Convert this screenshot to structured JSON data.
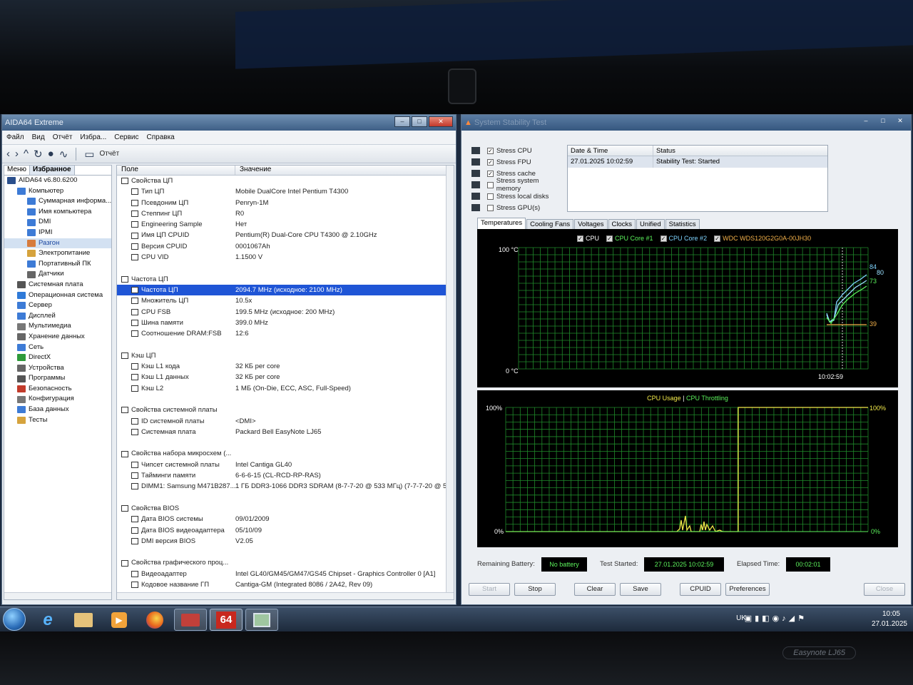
{
  "aida": {
    "title": "AIDA64 Extreme",
    "menu": [
      "Файл",
      "Вид",
      "Отчёт",
      "Избра...",
      "Сервис",
      "Справка"
    ],
    "toolbar_report": "Отчёт",
    "left_tabs": [
      "Меню",
      "Избранное"
    ],
    "tree": [
      {
        "label": "AIDA64 v6.80.6200",
        "color": "#2a4f8c",
        "indent": 0
      },
      {
        "label": "Компьютер",
        "color": "#3d7bd6",
        "indent": 1
      },
      {
        "label": "Суммарная информа...",
        "color": "#3d7bd6",
        "indent": 2
      },
      {
        "label": "Имя компьютера",
        "color": "#3d7bd6",
        "indent": 2
      },
      {
        "label": "DMI",
        "color": "#3d7bd6",
        "indent": 2
      },
      {
        "label": "IPMI",
        "color": "#3d7bd6",
        "indent": 2
      },
      {
        "label": "Разгон",
        "color": "#d67b3d",
        "indent": 2,
        "selected": true
      },
      {
        "label": "Электропитание",
        "color": "#d6a33d",
        "indent": 2
      },
      {
        "label": "Портативный ПК",
        "color": "#3d7bd6",
        "indent": 2
      },
      {
        "label": "Датчики",
        "color": "#666666",
        "indent": 2
      },
      {
        "label": "Системная плата",
        "color": "#555555",
        "indent": 1
      },
      {
        "label": "Операционная система",
        "color": "#2f7ad8",
        "indent": 1
      },
      {
        "label": "Сервер",
        "color": "#3d7bd6",
        "indent": 1
      },
      {
        "label": "Дисплей",
        "color": "#3d7bd6",
        "indent": 1
      },
      {
        "label": "Мультимедиа",
        "color": "#777777",
        "indent": 1
      },
      {
        "label": "Хранение данных",
        "color": "#666666",
        "indent": 1
      },
      {
        "label": "Сеть",
        "color": "#3d7bd6",
        "indent": 1
      },
      {
        "label": "DirectX",
        "color": "#2e9a3a",
        "indent": 1
      },
      {
        "label": "Устройства",
        "color": "#666666",
        "indent": 1
      },
      {
        "label": "Программы",
        "color": "#555555",
        "indent": 1
      },
      {
        "label": "Безопасность",
        "color": "#c23b2b",
        "indent": 1
      },
      {
        "label": "Конфигурация",
        "color": "#777777",
        "indent": 1
      },
      {
        "label": "База данных",
        "color": "#3d7bd6",
        "indent": 1
      },
      {
        "label": "Тесты",
        "color": "#d6a33d",
        "indent": 1
      }
    ],
    "columns": [
      "Поле",
      "Значение"
    ],
    "rows": [
      {
        "type": "sec",
        "field": "Свойства ЦП",
        "value": ""
      },
      {
        "type": "item",
        "field": "Тип ЦП",
        "value": "Mobile DualCore Intel Pentium T4300"
      },
      {
        "type": "item",
        "field": "Псевдоним ЦП",
        "value": "Penryn-1M"
      },
      {
        "type": "item",
        "field": "Степпинг ЦП",
        "value": "R0"
      },
      {
        "type": "item",
        "field": "Engineering Sample",
        "value": "Нет"
      },
      {
        "type": "item",
        "field": "Имя ЦП CPUID",
        "value": "Pentium(R) Dual-Core CPU T4300 @ 2.10GHz"
      },
      {
        "type": "item",
        "field": "Версия CPUID",
        "value": "0001067Ah"
      },
      {
        "type": "item",
        "field": "CPU VID",
        "value": "1.1500 V"
      },
      {
        "type": "gap",
        "field": "",
        "value": ""
      },
      {
        "type": "sec",
        "field": "Частота ЦП",
        "value": ""
      },
      {
        "type": "item",
        "field": "Частота ЦП",
        "value": "2094.7 MHz  (исходное: 2100 MHz)",
        "hl": true
      },
      {
        "type": "item",
        "field": "Множитель ЦП",
        "value": "10.5x"
      },
      {
        "type": "item",
        "field": "CPU FSB",
        "value": "199.5 MHz  (исходное: 200 MHz)"
      },
      {
        "type": "item",
        "field": "Шина памяти",
        "value": "399.0 MHz"
      },
      {
        "type": "item",
        "field": "Соотношение DRAM:FSB",
        "value": "12:6"
      },
      {
        "type": "gap",
        "field": "",
        "value": ""
      },
      {
        "type": "sec",
        "field": "Кэш ЦП",
        "value": ""
      },
      {
        "type": "item",
        "field": "Кэш L1 кода",
        "value": "32 КБ per core"
      },
      {
        "type": "item",
        "field": "Кэш L1 данных",
        "value": "32 КБ per core"
      },
      {
        "type": "item",
        "field": "Кэш L2",
        "value": "1 МБ  (On-Die, ECC, ASC, Full-Speed)"
      },
      {
        "type": "gap",
        "field": "",
        "value": ""
      },
      {
        "type": "sec",
        "field": "Свойства системной платы",
        "value": ""
      },
      {
        "type": "item",
        "field": "ID системной платы",
        "value": "<DMI>"
      },
      {
        "type": "item",
        "field": "Системная плата",
        "value": "Packard Bell EasyNote LJ65"
      },
      {
        "type": "gap",
        "field": "",
        "value": ""
      },
      {
        "type": "sec",
        "field": "Свойства набора микросхем (...",
        "value": ""
      },
      {
        "type": "item",
        "field": "Чипсет системной платы",
        "value": "Intel Cantiga GL40"
      },
      {
        "type": "item",
        "field": "Тайминги памяти",
        "value": "6-6-6-15  (CL-RCD-RP-RAS)"
      },
      {
        "type": "item",
        "field": "DIMM1: Samsung M471B287...",
        "value": "1 ГБ DDR3-1066 DDR3 SDRAM  (8-7-7-20 @ 533 МГц)  (7-7-7-20 @ 53"
      },
      {
        "type": "gap",
        "field": "",
        "value": ""
      },
      {
        "type": "sec",
        "field": "Свойства BIOS",
        "value": ""
      },
      {
        "type": "item",
        "field": "Дата BIOS системы",
        "value": "09/01/2009"
      },
      {
        "type": "item",
        "field": "Дата BIOS видеоадаптера",
        "value": "05/10/09"
      },
      {
        "type": "item",
        "field": "DMI версия BIOS",
        "value": "V2.05"
      },
      {
        "type": "gap",
        "field": "",
        "value": ""
      },
      {
        "type": "sec",
        "field": "Свойства графического проц...",
        "value": ""
      },
      {
        "type": "item",
        "field": "Видеоадаптер",
        "value": "Intel GL40/GM45/GM47/GS45 Chipset - Graphics Controller 0 [A1]"
      },
      {
        "type": "item",
        "field": "Кодовое название ГП",
        "value": "Cantiga-GM  (Integrated 8086 / 2A42, Rev 09)"
      }
    ]
  },
  "stability": {
    "title": "System Stability Test",
    "checks": [
      {
        "label": "Stress CPU",
        "checked": true
      },
      {
        "label": "Stress FPU",
        "checked": true
      },
      {
        "label": "Stress cache",
        "checked": true
      },
      {
        "label": "Stress system memory",
        "checked": false
      },
      {
        "label": "Stress local disks",
        "checked": false
      },
      {
        "label": "Stress GPU(s)",
        "checked": false
      }
    ],
    "status_table": {
      "headers": [
        "Date & Time",
        "Status"
      ],
      "row": [
        "27.01.2025 10:02:59",
        "Stability Test: Started"
      ]
    },
    "tabs": [
      "Temperatures",
      "Cooling Fans",
      "Voltages",
      "Clocks",
      "Unified",
      "Statistics"
    ],
    "temp_legend": [
      "CPU",
      "CPU Core #1",
      "CPU Core #2",
      "WDC WDS120G2G0A-00JH30"
    ],
    "temp_axis": {
      "top": "100 °C",
      "bottom": "0 °C",
      "time": "10:02:59"
    },
    "temp_values": {
      "core1": "84",
      "core2": "80",
      "cpu": "73",
      "disk": "39"
    },
    "usage_legend": {
      "a": "CPU Usage",
      "sep": "|",
      "b": "CPU Throttling"
    },
    "usage_axis": {
      "top_left": "100%",
      "bottom_left": "0%",
      "top_right": "100%",
      "bottom_right": "0%"
    },
    "status": {
      "battery_label": "Remaining Battery:",
      "battery_value": "No battery",
      "started_label": "Test Started:",
      "started_value": "27.01.2025 10:02:59",
      "elapsed_label": "Elapsed Time:",
      "elapsed_value": "00:02:01"
    },
    "buttons": [
      "Start",
      "Stop",
      "Clear",
      "Save",
      "CPUID",
      "Preferences",
      "Close"
    ]
  },
  "taskbar": {
    "lang": "UK",
    "time": "10:05",
    "date": "27.01.2025",
    "app_badge": "64"
  },
  "bezel": {
    "brand": "Easynote LJ65"
  }
}
